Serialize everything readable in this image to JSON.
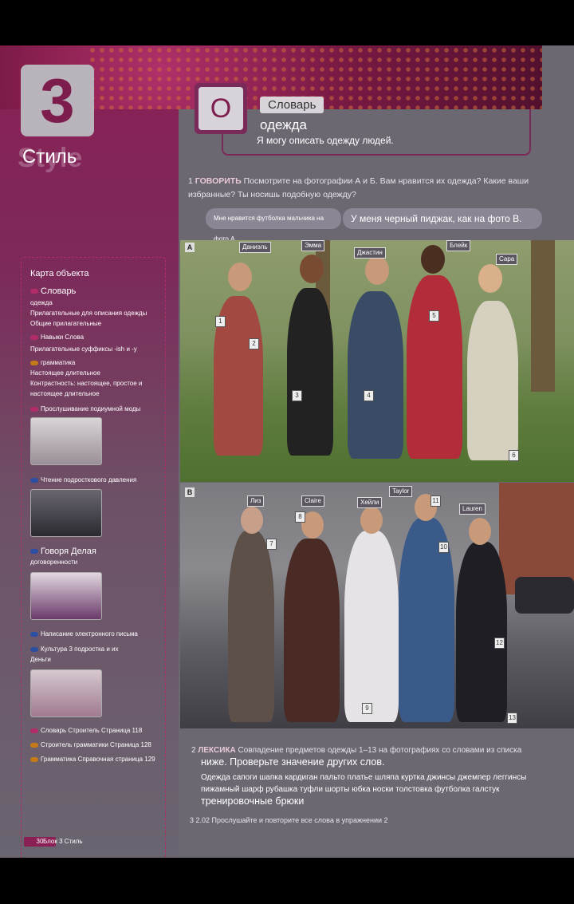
{
  "unit": {
    "number": "3",
    "title": "Стиль"
  },
  "lesson": {
    "badge": "О",
    "tab": "Словарь",
    "subtitle": "одежда",
    "can_do": "Я могу описать одежду людей."
  },
  "ex1": {
    "num": "1",
    "keyword": "ГОВОРИТЬ",
    "text": "Посмотрите на фотографии А и Б. Вам нравится их одежда? Какие ваши избранные? Ты носишь подобную одежду?"
  },
  "bubbles": {
    "left": "Мне нравится футболка мальчика на фото А.",
    "right": "У меня черный пиджак, как на фото В."
  },
  "photo_a": {
    "letter": "A",
    "names": [
      "Даниэль",
      "Эмма",
      "Джастин",
      "Блейк",
      "Сара"
    ],
    "numbers": [
      "1",
      "2",
      "3",
      "4",
      "5",
      "6"
    ]
  },
  "photo_b": {
    "letter": "B",
    "names": [
      "Лиз",
      "Claire",
      "Хейли",
      "Taylor",
      "Lauren"
    ],
    "numbers": [
      "7",
      "8",
      "9",
      "10",
      "11",
      "12",
      "13"
    ]
  },
  "map": {
    "title": "Карта объекта",
    "items": [
      {
        "label": "Словарь",
        "color": "#b22c6a"
      },
      {
        "label": "одежда"
      },
      {
        "label": "Прилагательные для описания одежды"
      },
      {
        "label": "Общие прилагательные"
      },
      {
        "label": "Навыки Слова",
        "color": "#b22c6a"
      },
      {
        "label": "Прилагательные суффиксы -ish и -y"
      },
      {
        "label": "грамматика",
        "color": "#c57a1a"
      },
      {
        "label": "Настоящее длительное"
      },
      {
        "label": "Контрастность: настоящее, простое и"
      },
      {
        "label": "настоящее длительное"
      },
      {
        "label": "Прослушивание подиумной моды",
        "color": "#b22c6a"
      },
      {
        "label": "Чтение подросткового давления",
        "color": "#2c4fa2"
      },
      {
        "label": "Говоря Делая",
        "color": "#2c4fa2"
      },
      {
        "label": "договоренности"
      },
      {
        "label": "Написание электронного письма",
        "color": "#2c4fa2"
      },
      {
        "label": "Культура 3 подростка и их",
        "color": "#2c4fa2"
      },
      {
        "label": "Деньги"
      },
      {
        "label": "Словарь Строитель Страница 118",
        "color": "#b22c6a"
      },
      {
        "label": "Строитель грамматики Страница 128",
        "color": "#c57a1a"
      },
      {
        "label": "Грамматика Справочная страница 129",
        "color": "#c57a1a"
      }
    ]
  },
  "ex2": {
    "num": "2",
    "keyword": "ЛЕКСИКА",
    "text": "Совпадение предметов одежды 1–13 на фотографиях со словами из списка",
    "text2": "ниже. Проверьте значение других слов.",
    "words": "Одежда сапоги шапка кардиган пальто платье шляпа куртка джинсы джемпер леггинсы пижамный шарф рубашка туфли шорты юбка носки толстовка футболка галстук",
    "words_big": "тренировочные брюки"
  },
  "ex3": {
    "text": "3 2.02 Прослушайте и повторите все слова в упражнении 2"
  },
  "footer": {
    "page": "30",
    "label": "Блок 3 Стиль"
  },
  "colors": {
    "accent": "#8a1f55",
    "blue": "#2c4fa2",
    "orange": "#c57a1a"
  }
}
